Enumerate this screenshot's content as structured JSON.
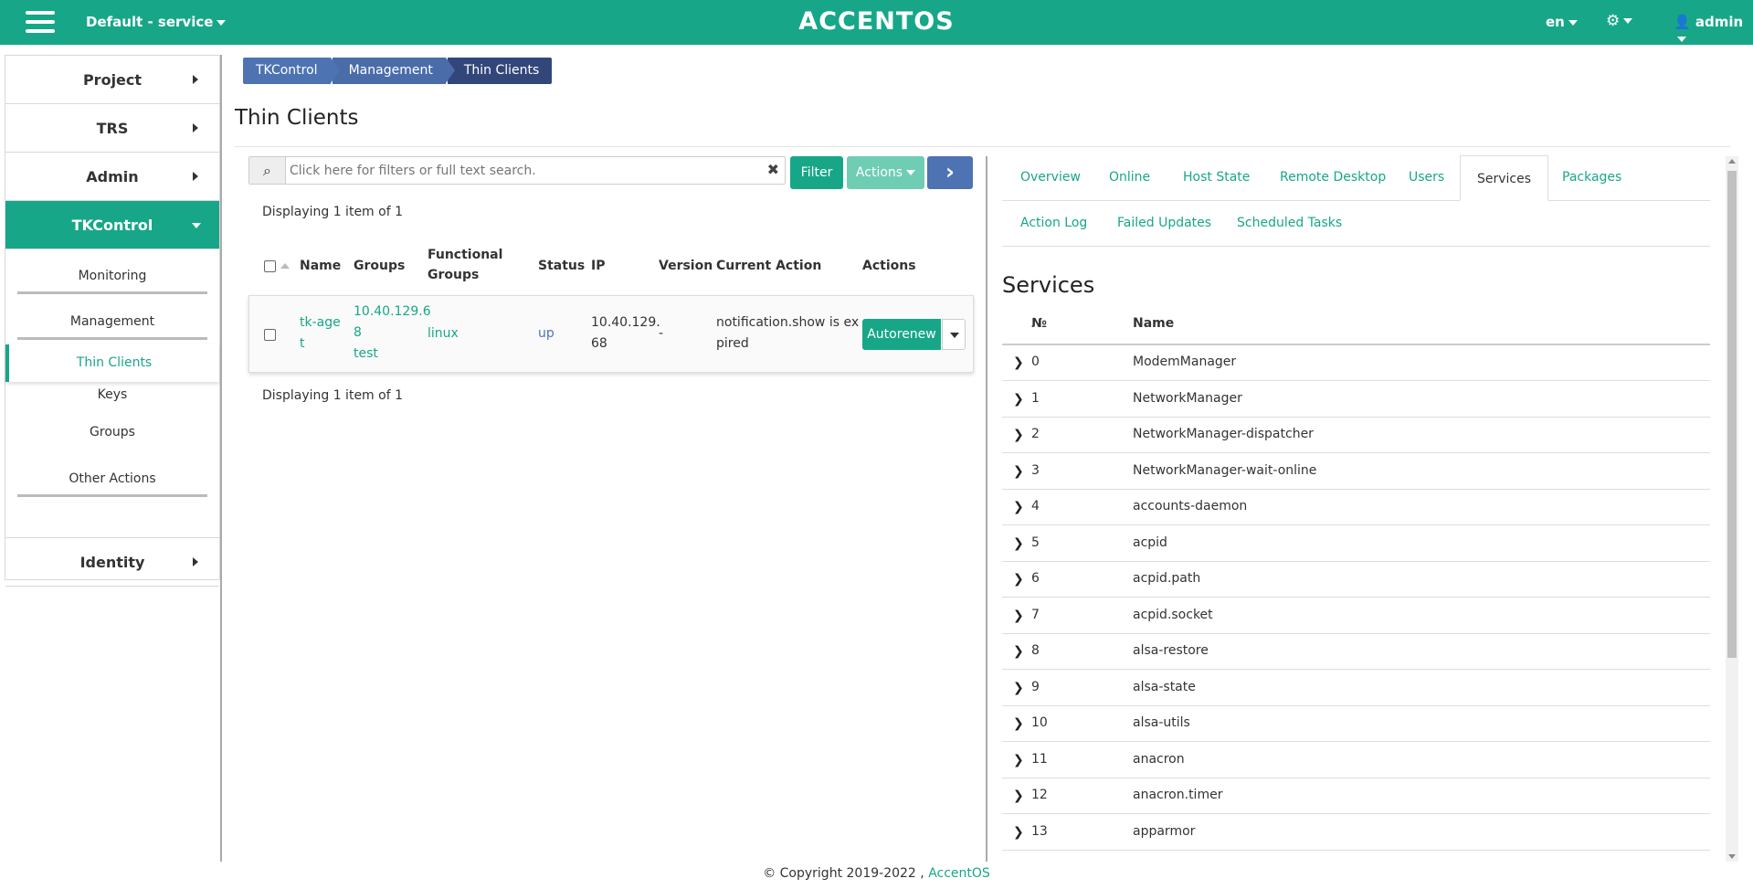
{
  "header": {
    "project_label": "Default - service",
    "logo": "ACCENTOS",
    "lang": "en",
    "user": "admin",
    "icons": {
      "menu": "hamburger-icon",
      "settings": "gear-icon",
      "user": "user-icon"
    }
  },
  "sidebar": {
    "sections": [
      {
        "label": "Project"
      },
      {
        "label": "TRS"
      },
      {
        "label": "Admin"
      },
      {
        "label": "TKControl"
      },
      {
        "label": "Identity"
      }
    ],
    "tkcontrol": {
      "monitoring": "Monitoring",
      "management": "Management",
      "thin_clients": "Thin Clients",
      "keys": "Keys",
      "groups": "Groups",
      "other_actions": "Other Actions"
    }
  },
  "breadcrumb": [
    "TKControl",
    "Management",
    "Thin Clients"
  ],
  "page_title": "Thin Clients",
  "search": {
    "placeholder": "Click here for filters or full text search."
  },
  "buttons": {
    "filter": "Filter",
    "actions": "Actions",
    "autorenew": "Autorenew"
  },
  "displaying": "Displaying 1 item of 1",
  "table": {
    "headers": {
      "name": "Name",
      "groups": "Groups",
      "functional_groups_1": "Functional",
      "functional_groups_2": "Groups",
      "status": "Status",
      "ip": "IP",
      "version": "Version",
      "current_action": "Current Action",
      "actions": "Actions"
    },
    "row": {
      "name_1": "tk-age",
      "name_2": "t",
      "groups_1": "10.40.129.6",
      "groups_2": "8",
      "groups_3": "test",
      "functional_groups": "linux",
      "status": "up",
      "ip_1": "10.40.129.",
      "ip_2": "68",
      "version": "-",
      "current_action_1": "notification.show is ex",
      "current_action_2": "pired"
    }
  },
  "tabs": {
    "overview": "Overview",
    "online": "Online",
    "host_state": "Host State",
    "remote_desktop": "Remote Desktop",
    "users": "Users",
    "services": "Services",
    "packages": "Packages",
    "action_log": "Action Log",
    "failed_updates": "Failed Updates",
    "scheduled_tasks": "Scheduled Tasks"
  },
  "services": {
    "title": "Services",
    "col_num": "№",
    "col_name": "Name",
    "rows": [
      {
        "num": "0",
        "name": "ModemManager"
      },
      {
        "num": "1",
        "name": "NetworkManager"
      },
      {
        "num": "2",
        "name": "NetworkManager-dispatcher"
      },
      {
        "num": "3",
        "name": "NetworkManager-wait-online"
      },
      {
        "num": "4",
        "name": "accounts-daemon"
      },
      {
        "num": "5",
        "name": "acpid"
      },
      {
        "num": "6",
        "name": "acpid.path"
      },
      {
        "num": "7",
        "name": "acpid.socket"
      },
      {
        "num": "8",
        "name": "alsa-restore"
      },
      {
        "num": "9",
        "name": "alsa-state"
      },
      {
        "num": "10",
        "name": "alsa-utils"
      },
      {
        "num": "11",
        "name": "anacron"
      },
      {
        "num": "12",
        "name": "anacron.timer"
      },
      {
        "num": "13",
        "name": "apparmor"
      }
    ]
  },
  "footer": {
    "copyright": "© Copyright 2019-2022 ,",
    "link": "AccentOS"
  }
}
